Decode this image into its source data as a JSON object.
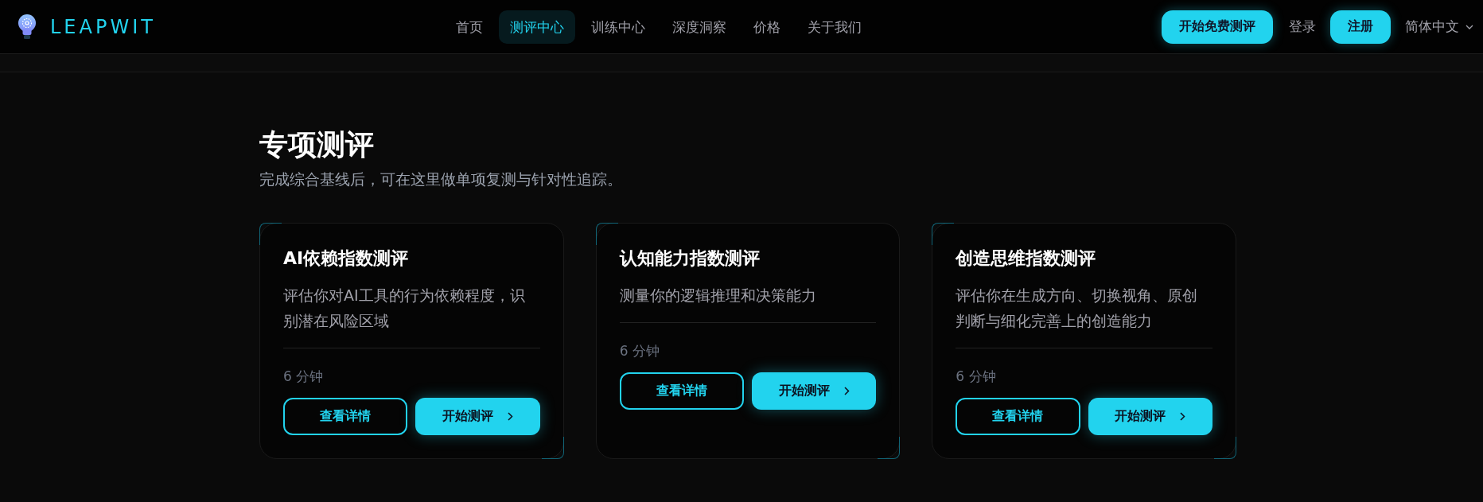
{
  "header": {
    "brand": "LEAPWIT",
    "nav": [
      {
        "label": "首页",
        "selected": false
      },
      {
        "label": "测评中心",
        "selected": true
      },
      {
        "label": "训练中心",
        "selected": false
      },
      {
        "label": "深度洞察",
        "selected": false
      },
      {
        "label": "价格",
        "selected": false
      },
      {
        "label": "关于我们",
        "selected": false
      }
    ],
    "actions": [
      {
        "label": "开始免费测评",
        "kind": "primary"
      },
      {
        "label": "登录",
        "kind": "link"
      },
      {
        "label": "注册",
        "kind": "primary"
      }
    ],
    "language": "简体中文"
  },
  "section": {
    "title": "专项测评",
    "subtitle": "完成综合基线后，可在这里做单项复测与针对性追踪。"
  },
  "cards": [
    {
      "title": "AI依赖指数测评",
      "description": "评估你对AI工具的行为依赖程度，识别潜在风险区域",
      "duration": "6 分钟",
      "buttons": [
        {
          "label": "查看详情",
          "kind": "outline"
        },
        {
          "label": "开始测评",
          "kind": "primary"
        }
      ]
    },
    {
      "title": "认知能力指数测评",
      "description": "测量你的逻辑推理和决策能力",
      "duration": "6 分钟",
      "buttons": [
        {
          "label": "查看详情",
          "kind": "outline"
        },
        {
          "label": "开始测评",
          "kind": "primary"
        }
      ]
    },
    {
      "title": "创造思维指数测评",
      "description": "评估你在生成方向、切换视角、原创判断与细化完善上的创造能力",
      "duration": "6 分钟",
      "buttons": [
        {
          "label": "查看详情",
          "kind": "outline"
        },
        {
          "label": "开始测评",
          "kind": "primary"
        }
      ]
    }
  ]
}
